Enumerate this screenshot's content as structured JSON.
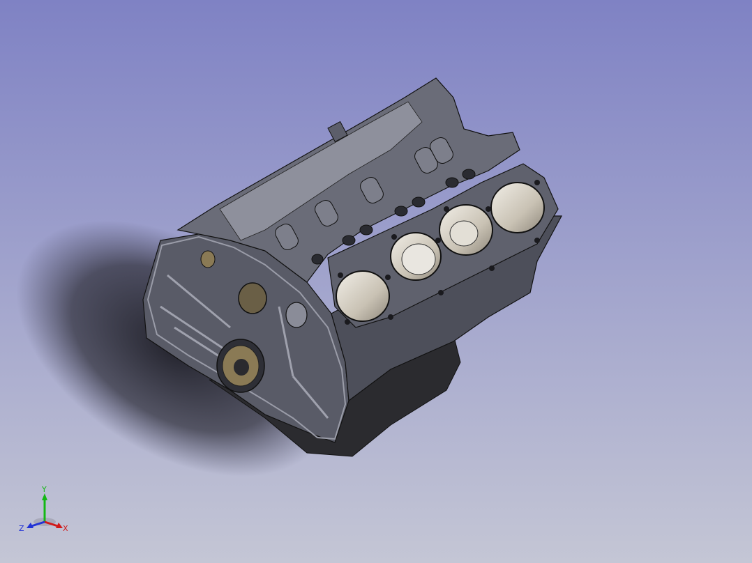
{
  "viewport": {
    "background_top": "#7f82c4",
    "background_bottom": "#c4c6d5"
  },
  "model": {
    "body_color": "#5a5c68",
    "body_dark": "#3b3c45",
    "body_light": "#8d8f9b",
    "bore_color": "#d8d4cc",
    "oil_pan_color": "#2b2b2f",
    "outline_color": "#111114"
  },
  "triad": {
    "x_label": "X",
    "y_label": "Y",
    "z_label": "Z",
    "x_color": "#d11a1a",
    "y_color": "#14b814",
    "z_color": "#2233d6"
  }
}
